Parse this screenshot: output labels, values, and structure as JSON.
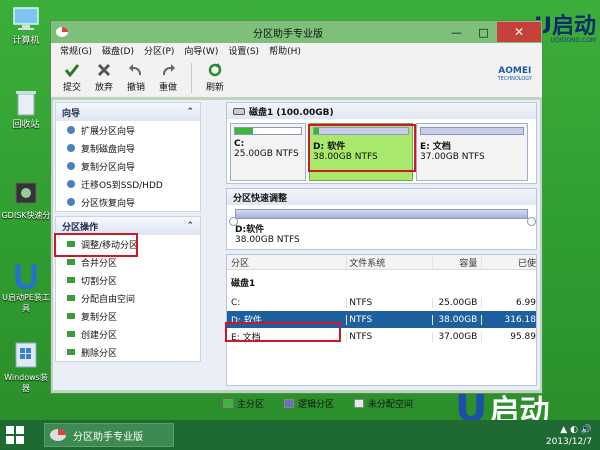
{
  "desktop": {
    "icons": [
      {
        "label": "计算机",
        "icon": "computer-icon"
      },
      {
        "label": "回收站",
        "icon": "recycle-bin-icon"
      },
      {
        "label": "GDISK快速分",
        "icon": "gdisk-icon"
      },
      {
        "label": "U启动PE装工具",
        "icon": "u-qidong-icon"
      },
      {
        "label": "Windows装器",
        "icon": "windows-installer-icon"
      }
    ],
    "brand": {
      "text": "U启动",
      "sub": "UQIDONG.COM"
    },
    "logo": "启动"
  },
  "window": {
    "title": "分区助手专业版",
    "controls": {
      "minimize": "—",
      "maximize": "□",
      "close": "✕"
    },
    "menu": [
      "常规(G)",
      "磁盘(D)",
      "分区(P)",
      "向导(W)",
      "设置(S)",
      "帮助(H)"
    ],
    "toolbar": {
      "items": [
        {
          "label": "提交",
          "icon": "check-icon"
        },
        {
          "label": "放弃",
          "icon": "discard-icon"
        },
        {
          "label": "撤销",
          "icon": "undo-icon"
        },
        {
          "label": "重做",
          "icon": "redo-icon"
        },
        {
          "label": "刷新",
          "icon": "refresh-icon"
        }
      ],
      "logo": {
        "name": "AOMEI",
        "sub": "TECHNOLOGY"
      }
    }
  },
  "sidebar": {
    "wizard": {
      "title": "向导",
      "items": [
        "扩展分区向导",
        "复制磁盘向导",
        "复制分区向导",
        "迁移OS到SSD/HDD",
        "分区恢复向导"
      ]
    },
    "ops": {
      "title": "分区操作",
      "items": [
        "调整/移动分区",
        "合并分区",
        "切割分区",
        "分配自由空间",
        "复制分区",
        "创建分区",
        "删除分区"
      ]
    }
  },
  "disk": {
    "header": "磁盘1 (100.00GB)",
    "partitions": [
      {
        "label": "C:",
        "size": "25.00GB NTFS",
        "fill": 0.28
      },
      {
        "label": "D: 软件",
        "size": "38.00GB NTFS",
        "fill": 0.05
      },
      {
        "label": "E: 文档",
        "size": "37.00GB NTFS",
        "fill": 0.0
      }
    ]
  },
  "quick": {
    "title": "分区快速调整",
    "label": "D:软件",
    "size": "38.00GB NTFS"
  },
  "table": {
    "headers": [
      "分区",
      "文件系统",
      "容量",
      "已使"
    ],
    "disk_row": "磁盘1",
    "rows": [
      {
        "name": "C:",
        "fs": "NTFS",
        "cap": "25.00GB",
        "used": "6.99"
      },
      {
        "name": "D: 软件",
        "fs": "NTFS",
        "cap": "38.00GB",
        "used": "316.18"
      },
      {
        "name": "E: 文档",
        "fs": "NTFS",
        "cap": "37.00GB",
        "used": "95.89"
      }
    ]
  },
  "legend": [
    "主分区",
    "逻辑分区",
    "未分配空间"
  ],
  "taskbar": {
    "task": "分区助手专业版",
    "date": "2013/12/7"
  },
  "colors": {
    "accent": "#1e5f9e",
    "highlight": "#d0162a",
    "primary_green": "#3bb53b"
  }
}
